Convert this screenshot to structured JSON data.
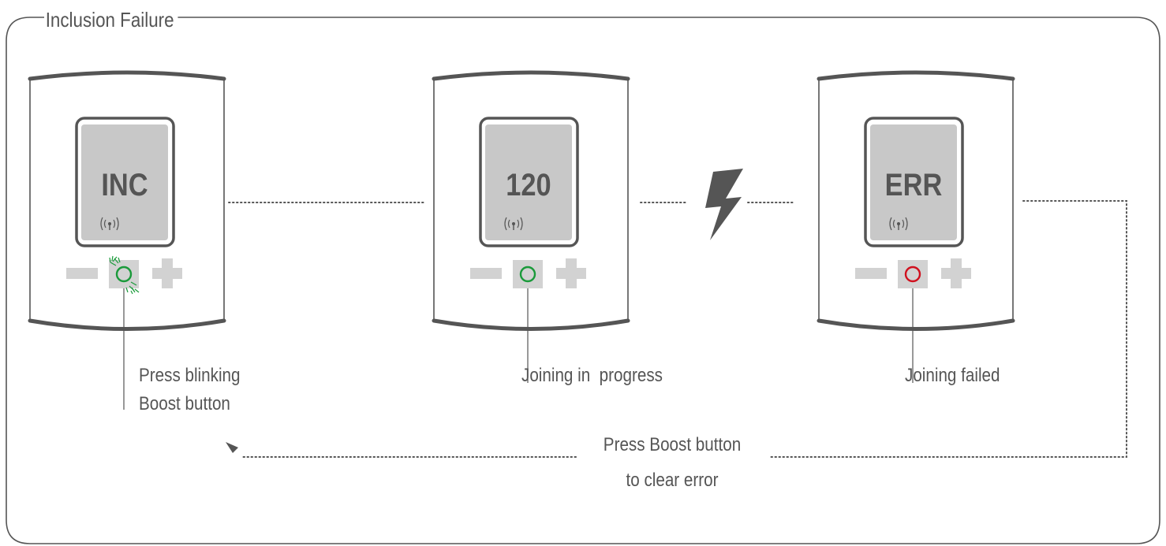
{
  "title": "Inclusion Failure",
  "devices": [
    {
      "display": "INC",
      "led_color": "#1a9a3a",
      "led_blinking": true,
      "caption": [
        "Press blinking",
        "Boost button"
      ]
    },
    {
      "display": "120",
      "led_color": "#1a9a3a",
      "led_blinking": false,
      "caption": [
        "Joining in  progress"
      ]
    },
    {
      "display": "ERR",
      "led_color": "#d0101e",
      "led_blinking": false,
      "caption": [
        "Joining failed"
      ]
    }
  ],
  "return_instruction": [
    "Press Boost button",
    "to clear error"
  ],
  "icons": {
    "signal": "wireless-signal-icon",
    "minus": "minus-icon",
    "plus": "plus-icon",
    "boost": "boost-button-icon",
    "interference": "lightning-bolt-icon",
    "return_arrow": "arrowhead-icon"
  },
  "colors": {
    "frame": "#555555",
    "device_outline": "#555555",
    "screen": "#c8c8c8",
    "button": "#d2d2d2",
    "text": "#555555",
    "led_green": "#1a9a3a",
    "led_red": "#d0101e"
  }
}
